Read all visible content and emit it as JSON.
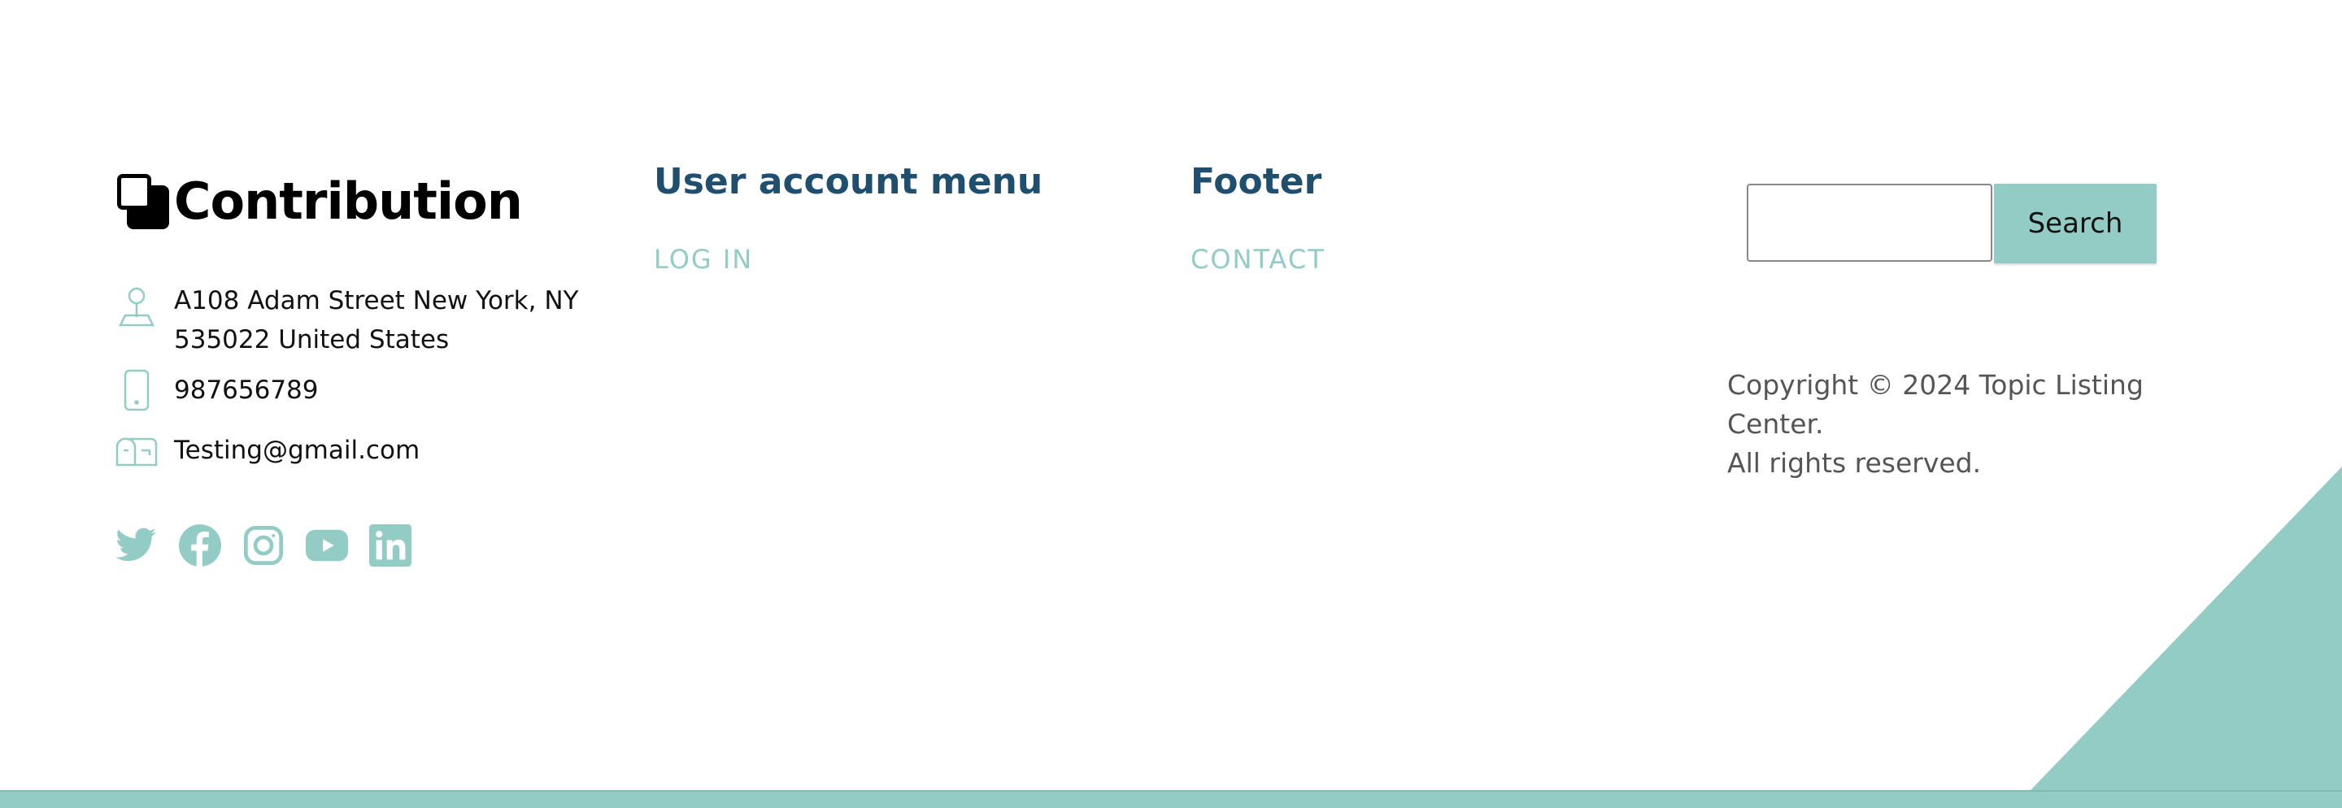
{
  "brand": {
    "name": "Contribution",
    "logo_icon": "overlapping-squares-icon"
  },
  "contact": {
    "address_line1": "A108 Adam Street New York, NY",
    "address_line2": "535022 United States",
    "phone": "987656789",
    "email": "Testing@gmail.com",
    "icons": [
      "map-pin-icon",
      "phone-icon",
      "mailbox-icon"
    ]
  },
  "social": [
    "twitter-icon",
    "facebook-icon",
    "instagram-icon",
    "youtube-icon",
    "linkedin-icon"
  ],
  "menus": {
    "user_account": {
      "title": "User account menu",
      "links": [
        "LOG IN"
      ]
    },
    "footer": {
      "title": "Footer",
      "links": [
        "CONTACT"
      ]
    }
  },
  "search": {
    "value": "",
    "button_label": "Search"
  },
  "copyright": {
    "line1": "Copyright © 2024 Topic Listing Center.",
    "line2": "All rights reserved."
  },
  "colors": {
    "accent": "#92ccc5",
    "heading": "#1f4e6e",
    "text": "#111111",
    "muted": "#555555"
  }
}
